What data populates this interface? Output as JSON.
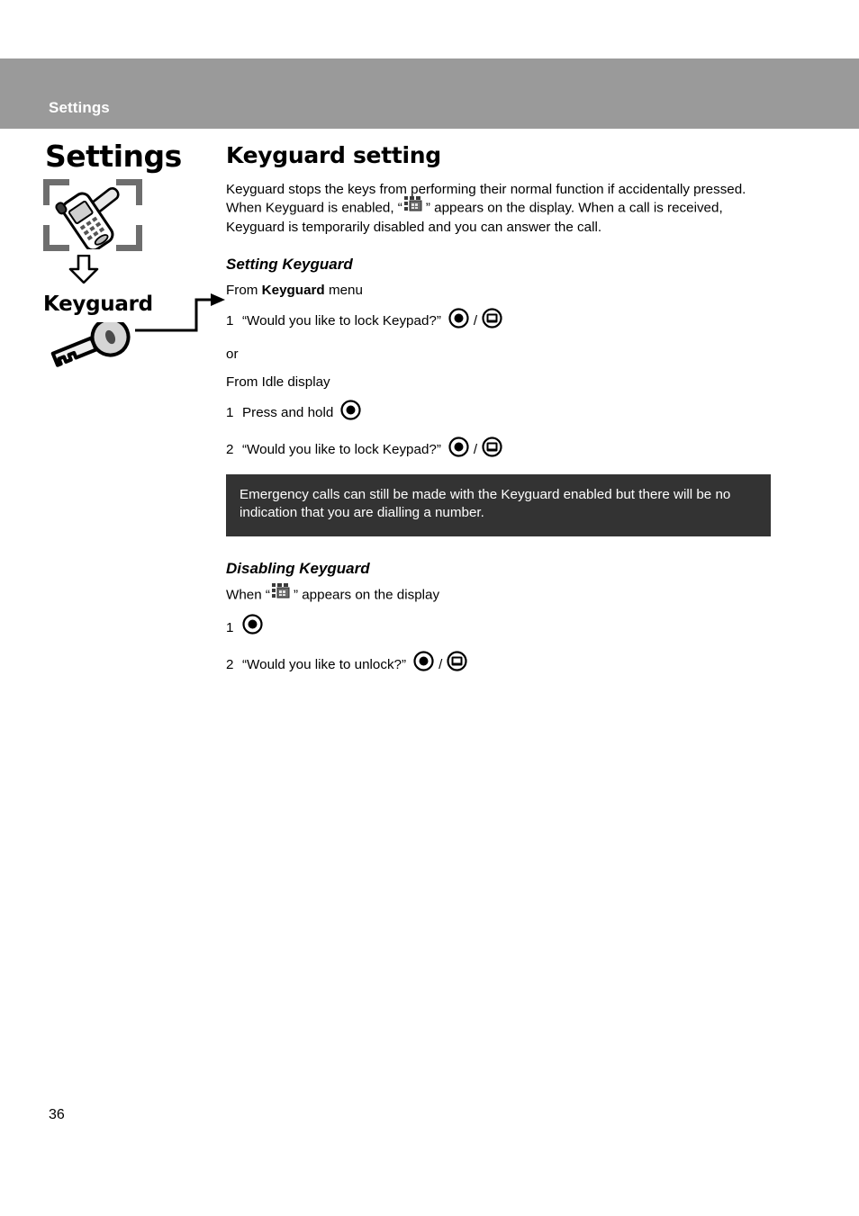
{
  "header": {
    "running_title": "Settings"
  },
  "sidebar": {
    "title": "Settings",
    "label": "Keyguard",
    "phone_icon": "phone-with-screwdriver-icon",
    "arrow_icon": "down-arrow-icon",
    "key_icon": "key-icon",
    "connector": "connector-arrow"
  },
  "content": {
    "section_title": "Keyguard setting",
    "intro_part1": "Keyguard stops the keys from performing their normal function if accidentally pressed. When Keyguard is enabled, “",
    "intro_part2": "” appears on the display. When a call is received, Keyguard is temporarily disabled and you can answer the call.",
    "setting": {
      "sub_title": "Setting Keyguard",
      "lead_prefix": "From ",
      "lead_bold": "Keyguard",
      "lead_suffix": " menu",
      "step1_num": "1",
      "step1_text": "“Would you like to lock Keypad?”",
      "or_text": "or",
      "lead2": "From Idle display",
      "step2_num": "1",
      "step2_text": "Press and hold",
      "step3_num": "2",
      "step3_text": "“Would you like to lock Keypad?”",
      "separator": "/"
    },
    "note": "Emergency calls can still be made with the Keyguard enabled but there will be no indication that you are dialling a number.",
    "disabling": {
      "sub_title": "Disabling Keyguard",
      "lead_prefix": "When “",
      "lead_suffix": "” appears on the display",
      "step1_num": "1",
      "step2_num": "2",
      "step2_text": "“Would you like to unlock?”",
      "separator": "/"
    },
    "icons": {
      "select_key": "select-key-icon",
      "soft_key": "soft-key-icon",
      "keypad_lock": "keypad-lock-icon"
    }
  },
  "footer": {
    "page_number": "36"
  },
  "colors": {
    "header_bar": "#9a9a9a",
    "note_box": "#333333",
    "bracket": "#6e6e6e",
    "text": "#000000"
  }
}
